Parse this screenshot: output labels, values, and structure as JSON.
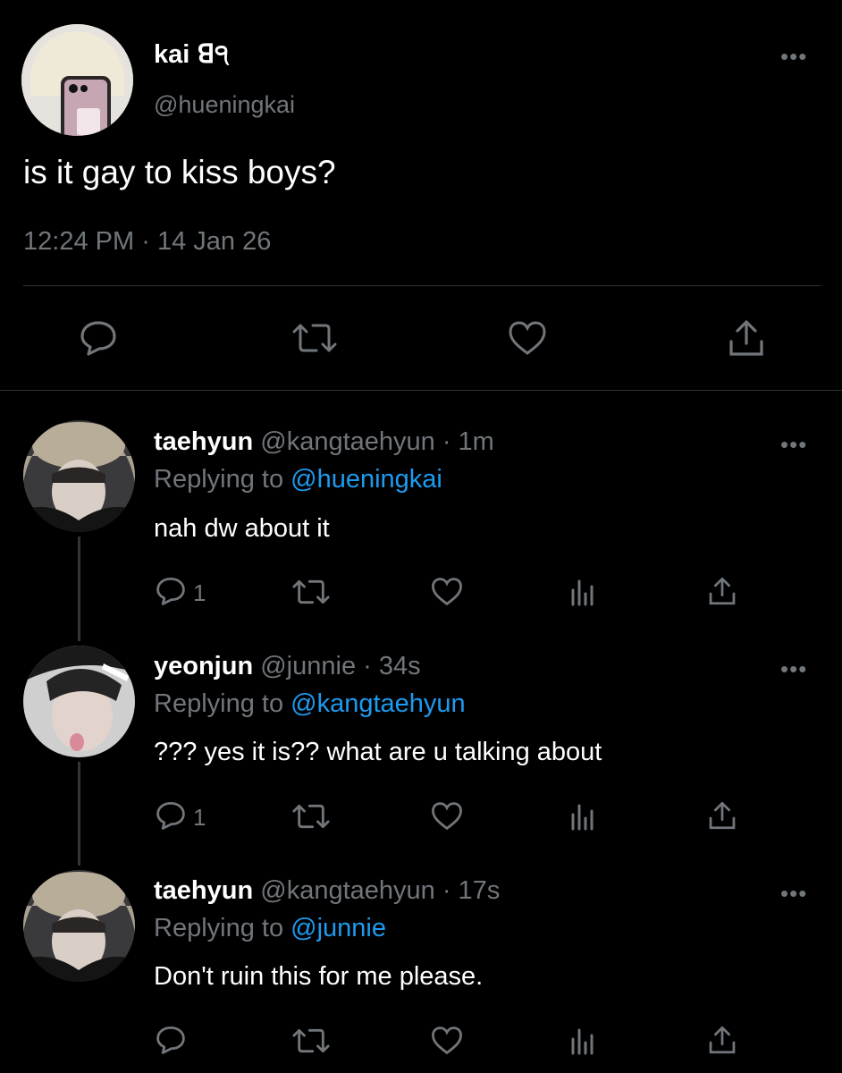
{
  "main_tweet": {
    "display_name": "kai",
    "name_suffix": "ꓭ੧",
    "handle": "@hueningkai",
    "text": "is it gay to kiss boys?",
    "time": "12:24 PM",
    "separator": "·",
    "date": "14 Jan 26",
    "icons": [
      "reply-icon",
      "retweet-icon",
      "like-icon",
      "share-icon"
    ]
  },
  "replies": [
    {
      "display_name": "taehyun",
      "handle": "@kangtaehyun",
      "age": "· 1m",
      "replying_prefix": "Replying to",
      "replying_to": "@hueningkai",
      "text": "nah dw about it",
      "reply_count": "1"
    },
    {
      "display_name": "yeonjun",
      "handle": "@junnie",
      "age": "· 34s",
      "replying_prefix": "Replying to",
      "replying_to": "@kangtaehyun",
      "text": "??? yes it is?? what are u talking about",
      "reply_count": "1"
    },
    {
      "display_name": "taehyun",
      "handle": "@kangtaehyun",
      "age": "· 17s",
      "replying_prefix": "Replying to",
      "replying_to": "@junnie",
      "text": "Don't ruin this for me please.",
      "reply_count": ""
    }
  ],
  "colors": {
    "background": "#000000",
    "muted": "#71767b",
    "link": "#1d9bf0",
    "divider": "#2f3336"
  }
}
